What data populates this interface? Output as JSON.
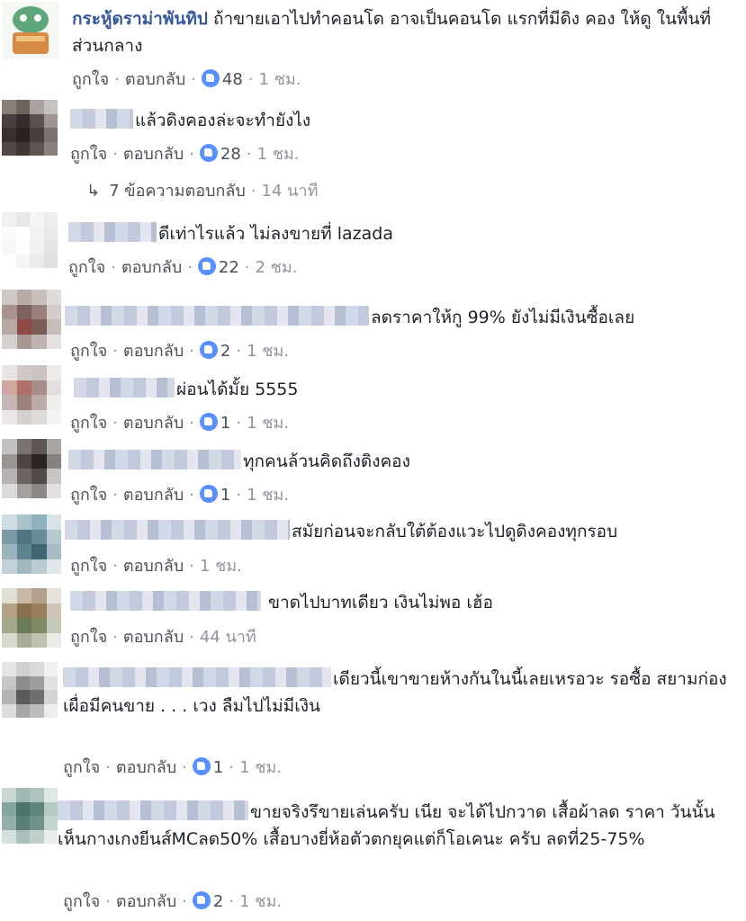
{
  "comments": [
    {
      "name": "กระหู้ดราม่าพันทิป",
      "text": "ถ้าขายเอาไปทำคอนโด อาจเป็นคอนโด แรกที่มีดิง คอง ให้ดู ในพื้นที่ส่วนกลาง",
      "like": "ถูกใจ",
      "reply": "ตอบกลับ",
      "reactions": "48",
      "time": "1 ชม."
    },
    {
      "text": "แล้วดิงคองล่ะจะทำยังไง",
      "like": "ถูกใจ",
      "reply": "ตอบกลับ",
      "reactions": "28",
      "time": "1 ชม."
    },
    {
      "text": "ดีเท่าไรแล้ว ไม่ลงขายที่ lazada",
      "like": "ถูกใจ",
      "reply": "ตอบกลับ",
      "reactions": "22",
      "time": "2 ชม."
    },
    {
      "text": "ลดราคาให้กู 99% ยังไม่มีเงินซื้อเลย",
      "like": "ถูกใจ",
      "reply": "ตอบกลับ",
      "reactions": "2",
      "time": "1 ชม."
    },
    {
      "text": "ผ่อนได้มั้ย 5555",
      "like": "ถูกใจ",
      "reply": "ตอบกลับ",
      "reactions": "1",
      "time": "1 ชม."
    },
    {
      "text": "ทุกคนล้วนคิดถึงดิงคอง",
      "like": "ถูกใจ",
      "reply": "ตอบกลับ",
      "reactions": "1",
      "time": "1 ชม."
    },
    {
      "text": "สมัยก่อนจะกลับใต้ต้องแวะไปดูดิงคองทุกรอบ",
      "like": "ถูกใจ",
      "reply": "ตอบกลับ",
      "time": "1 ชม."
    },
    {
      "text": "ขาดไปบาทเดียว เงินไม่พอ เฮ้อ",
      "like": "ถูกใจ",
      "reply": "ตอบกลับ",
      "time": "44 นาที"
    },
    {
      "text": "เดียวนี้เขาขายห้างกันในนี้เลยเหรอวะ รอซื้อ สยามก่อง เผื่อมีคนขาย . . . เวง ลืมไปไม่มีเงิน",
      "like": "ถูกใจ",
      "reply": "ตอบกลับ",
      "reactions": "1",
      "time": "1 ชม."
    },
    {
      "text": "ขายจริงรึขายเล่นครับ เนีย จะได้ไปกวาด เสื้อผ้าลด ราคา วันนั้นเห็นกางเกงยีนส์MCลด50% เสื้อบางยี่ห้อตัวตกยุคแต่ก็โอเคนะ ครับ ลดที่25-75%",
      "like": "ถูกใจ",
      "reply": "ตอบกลับ",
      "reactions": "2",
      "time": "1 ชม."
    }
  ],
  "replies_link": {
    "text": "7 ข้อความตอบกลับ",
    "time": "14 นาที"
  },
  "colors": {
    "link": "#365899",
    "meta": "#90949c",
    "like_blue": "#5890ff"
  }
}
